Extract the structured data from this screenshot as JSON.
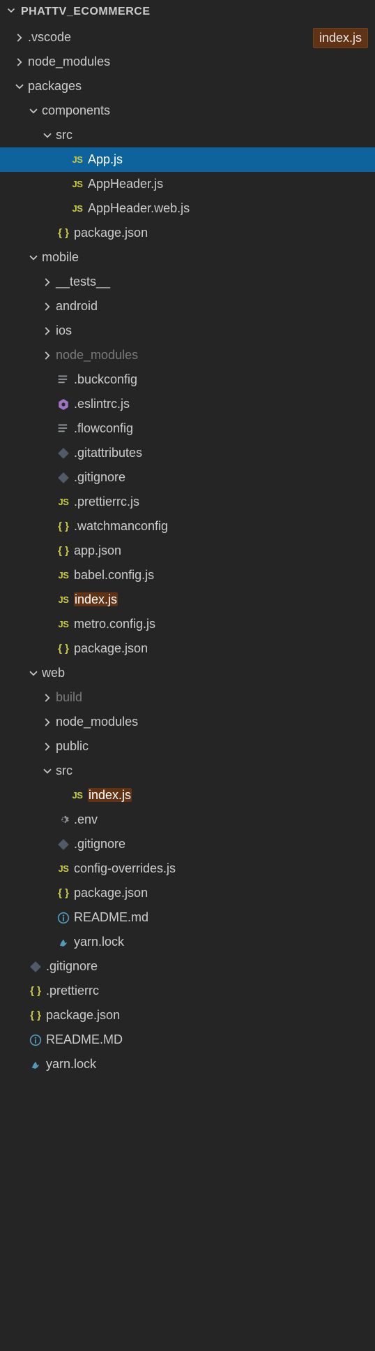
{
  "header": {
    "title": "PHATTV_ECOMMERCE"
  },
  "badge": "index.js",
  "tree": {
    "vscode": ".vscode",
    "node_modules": "node_modules",
    "packages": "packages",
    "components": "components",
    "src": "src",
    "app_js": "App.js",
    "appheader_js": "AppHeader.js",
    "appheader_web_js": "AppHeader.web.js",
    "components_pkg": "package.json",
    "mobile": "mobile",
    "tests": "__tests__",
    "android": "android",
    "ios": "ios",
    "mobile_nm": "node_modules",
    "buckconfig": ".buckconfig",
    "eslintrc": ".eslintrc.js",
    "flowconfig": ".flowconfig",
    "gitattributes": ".gitattributes",
    "mobile_gitignore": ".gitignore",
    "prettierrc_js": ".prettierrc.js",
    "watchmanconfig": ".watchmanconfig",
    "app_json": "app.json",
    "babel_config": "babel.config.js",
    "mobile_index": "index.js",
    "metro_config": "metro.config.js",
    "mobile_pkg": "package.json",
    "web": "web",
    "build": "build",
    "web_nm": "node_modules",
    "public": "public",
    "web_src": "src",
    "web_index": "index.js",
    "env": ".env",
    "web_gitignore": ".gitignore",
    "config_overrides": "config-overrides.js",
    "web_pkg": "package.json",
    "web_readme": "README.md",
    "web_yarn": "yarn.lock",
    "root_gitignore": ".gitignore",
    "root_prettierrc": ".prettierrc",
    "root_pkg": "package.json",
    "root_readme": "README.MD",
    "root_yarn": "yarn.lock"
  },
  "icons": {
    "js": "JS",
    "json": "{ }"
  }
}
